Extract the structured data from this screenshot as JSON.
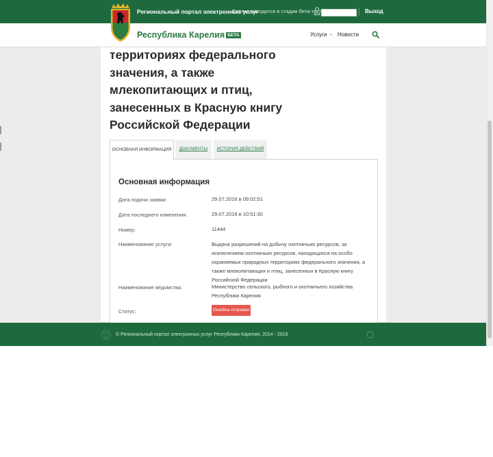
{
  "topbar": {
    "portal_name": "Региональный портал электронных услуг",
    "beta_note": "Портал находится в стадии бета-тестирования",
    "login_value": "",
    "logout": "Выход"
  },
  "navbar": {
    "brand": "Республика Карелия",
    "beta_badge": "БЕТА",
    "items": [
      "Услуги",
      "Новости"
    ],
    "separator": "•"
  },
  "heading": "территориях федерального значения, а также млекопитающих и птиц, занесенных в Красную книгу Российской Федерации",
  "tabs": [
    {
      "label": "Основная информация",
      "active": true
    },
    {
      "label": "Документы",
      "active": false
    },
    {
      "label": "История действий",
      "active": false
    }
  ],
  "info": {
    "title": "Основная информация",
    "rows": [
      {
        "label": "Дата подачи заявки:",
        "value": "29.07.2016 в 09:02:51"
      },
      {
        "label": "Дата последнего изменения:",
        "value": "29.07.2016 в 10:51:30"
      },
      {
        "label": "Номер:",
        "value": "11444"
      },
      {
        "label": "Наименование услуги:",
        "value": "Выдача разрешений на добычу охотничьих ресурсов, за исключением охотничьих ресурсов, находящихся на особо охраняемых природных территориях федерального значения, а также млекопитающих и птиц, занесенных в Красную книгу Российской Федерации"
      },
      {
        "label": "Наименование ведомства:",
        "value": "Министерство сельского, рыбного и охотничьего хозяйства Республики Карелия"
      },
      {
        "label": "Статус:",
        "value": ""
      }
    ],
    "status": "Ошибка отправки"
  },
  "footer": {
    "text": "© Региональный портал электронных услуг Республики Карелия, 2014 - 2016"
  },
  "colors": {
    "primary": "#1e6a3e",
    "accent": "#2b7a46",
    "status_error": "#e5574f"
  },
  "icons": [
    "emblem-icon",
    "user-icon",
    "search-icon",
    "footer-logo-icon",
    "footer-icon"
  ]
}
